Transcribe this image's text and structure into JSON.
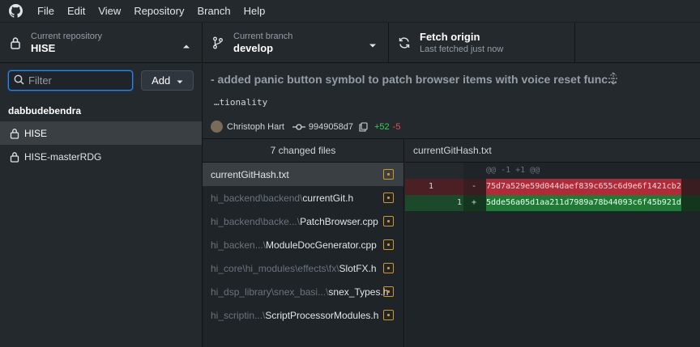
{
  "menu": [
    "File",
    "Edit",
    "View",
    "Repository",
    "Branch",
    "Help"
  ],
  "toolbar": {
    "repo_label": "Current repository",
    "repo_value": "HISE",
    "branch_label": "Current branch",
    "branch_value": "develop",
    "fetch_title": "Fetch origin",
    "fetch_sub": "Last fetched just now"
  },
  "sidebar": {
    "filter_placeholder": "Filter",
    "add_label": "Add",
    "group": "dabbudebendra",
    "repos": [
      "HISE",
      "HISE-masterRDG"
    ]
  },
  "commit": {
    "title": "- added panic button symbol to patch browser items with voice reset func...",
    "body": "…tionality",
    "author": "Christoph Hart",
    "sha": "9949058d7",
    "additions": "+52",
    "deletions": "-5"
  },
  "files": {
    "header": "7 changed files",
    "items": [
      {
        "dir": "",
        "name": "currentGitHash.txt"
      },
      {
        "dir": "hi_backend\\backend\\",
        "name": "currentGit.h"
      },
      {
        "dir": "hi_backend\\backe...\\",
        "name": "PatchBrowser.cpp"
      },
      {
        "dir": "hi_backen...\\",
        "name": "ModuleDocGenerator.cpp"
      },
      {
        "dir": "hi_core\\hi_modules\\effects\\fx\\",
        "name": "SlotFX.h"
      },
      {
        "dir": "hi_dsp_library\\snex_basi...\\",
        "name": "snex_Types.h"
      },
      {
        "dir": "hi_scriptin...\\",
        "name": "ScriptProcessorModules.h"
      }
    ]
  },
  "diff": {
    "file": "currentGitHash.txt",
    "hunk": "@@ -1 +1 @@",
    "del_old": "1",
    "del_sign": "-",
    "del_code": "75d7a529e59d044daef839c655c6d9e6f1421cb2",
    "ins_new": "1",
    "ins_sign": "+",
    "ins_code": "5dde56a05d1aa211d7989a78b44093c6f45b921d"
  }
}
